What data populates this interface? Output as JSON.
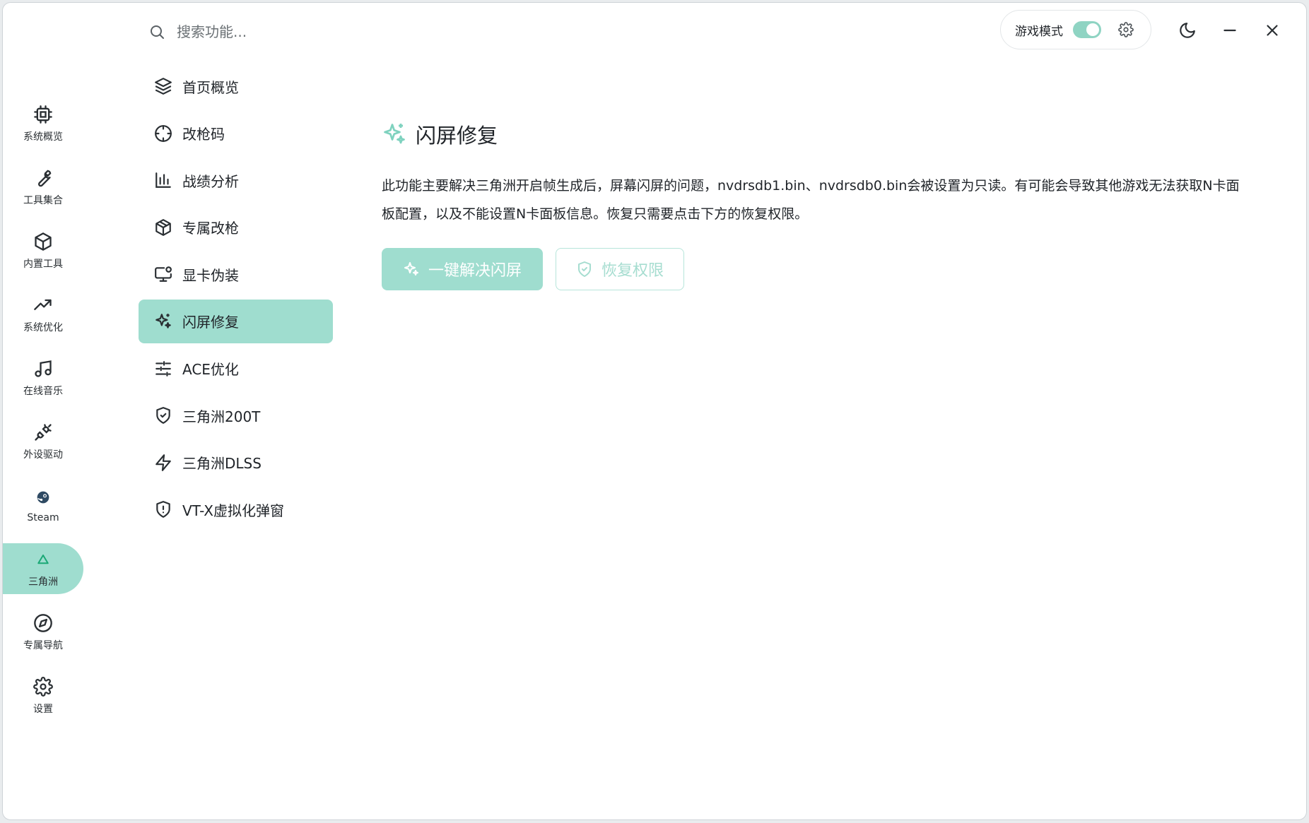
{
  "search": {
    "placeholder": "搜索功能..."
  },
  "topbar": {
    "game_mode_label": "游戏模式",
    "game_mode_on": true
  },
  "rail": {
    "items": [
      {
        "label": "系统概览",
        "icon": "cpu-icon"
      },
      {
        "label": "工具集合",
        "icon": "wrench-icon"
      },
      {
        "label": "内置工具",
        "icon": "package-icon"
      },
      {
        "label": "系统优化",
        "icon": "trending-up-icon"
      },
      {
        "label": "在线音乐",
        "icon": "music-icon"
      },
      {
        "label": "外设驱动",
        "icon": "plug-icon"
      },
      {
        "label": "Steam",
        "icon": "steam-icon"
      },
      {
        "label": "三角洲",
        "icon": "triangle-icon",
        "active": true
      },
      {
        "label": "专属导航",
        "icon": "compass-icon"
      },
      {
        "label": "设置",
        "icon": "gear-icon"
      }
    ]
  },
  "menu": {
    "items": [
      {
        "label": "首页概览",
        "icon": "layers-icon"
      },
      {
        "label": "改枪码",
        "icon": "crosshair-icon"
      },
      {
        "label": "战绩分析",
        "icon": "bar-chart-icon"
      },
      {
        "label": "专属改枪",
        "icon": "box-icon"
      },
      {
        "label": "显卡伪装",
        "icon": "monitor-cog-icon"
      },
      {
        "label": "闪屏修复",
        "icon": "sparkles-icon",
        "active": true
      },
      {
        "label": "ACE优化",
        "icon": "sliders-icon"
      },
      {
        "label": "三角洲200T",
        "icon": "shield-check-icon"
      },
      {
        "label": "三角洲DLSS",
        "icon": "zap-icon"
      },
      {
        "label": "VT-X虚拟化弹窗",
        "icon": "shield-alert-icon"
      }
    ]
  },
  "content": {
    "title": "闪屏修复",
    "description": "此功能主要解决三角洲开启帧生成后，屏幕闪屏的问题，nvdrsdb1.bin、nvdrsdb0.bin会被设置为只读。有可能会导致其他游戏无法获取N卡面板配置，以及不能设置N卡面板信息。恢复只需要点击下方的恢复权限。",
    "primary_button": "一键解决闪屏",
    "secondary_button": "恢复权限"
  },
  "colors": {
    "accent": "#9fddcf",
    "accent_text": "#7fd2bf"
  }
}
